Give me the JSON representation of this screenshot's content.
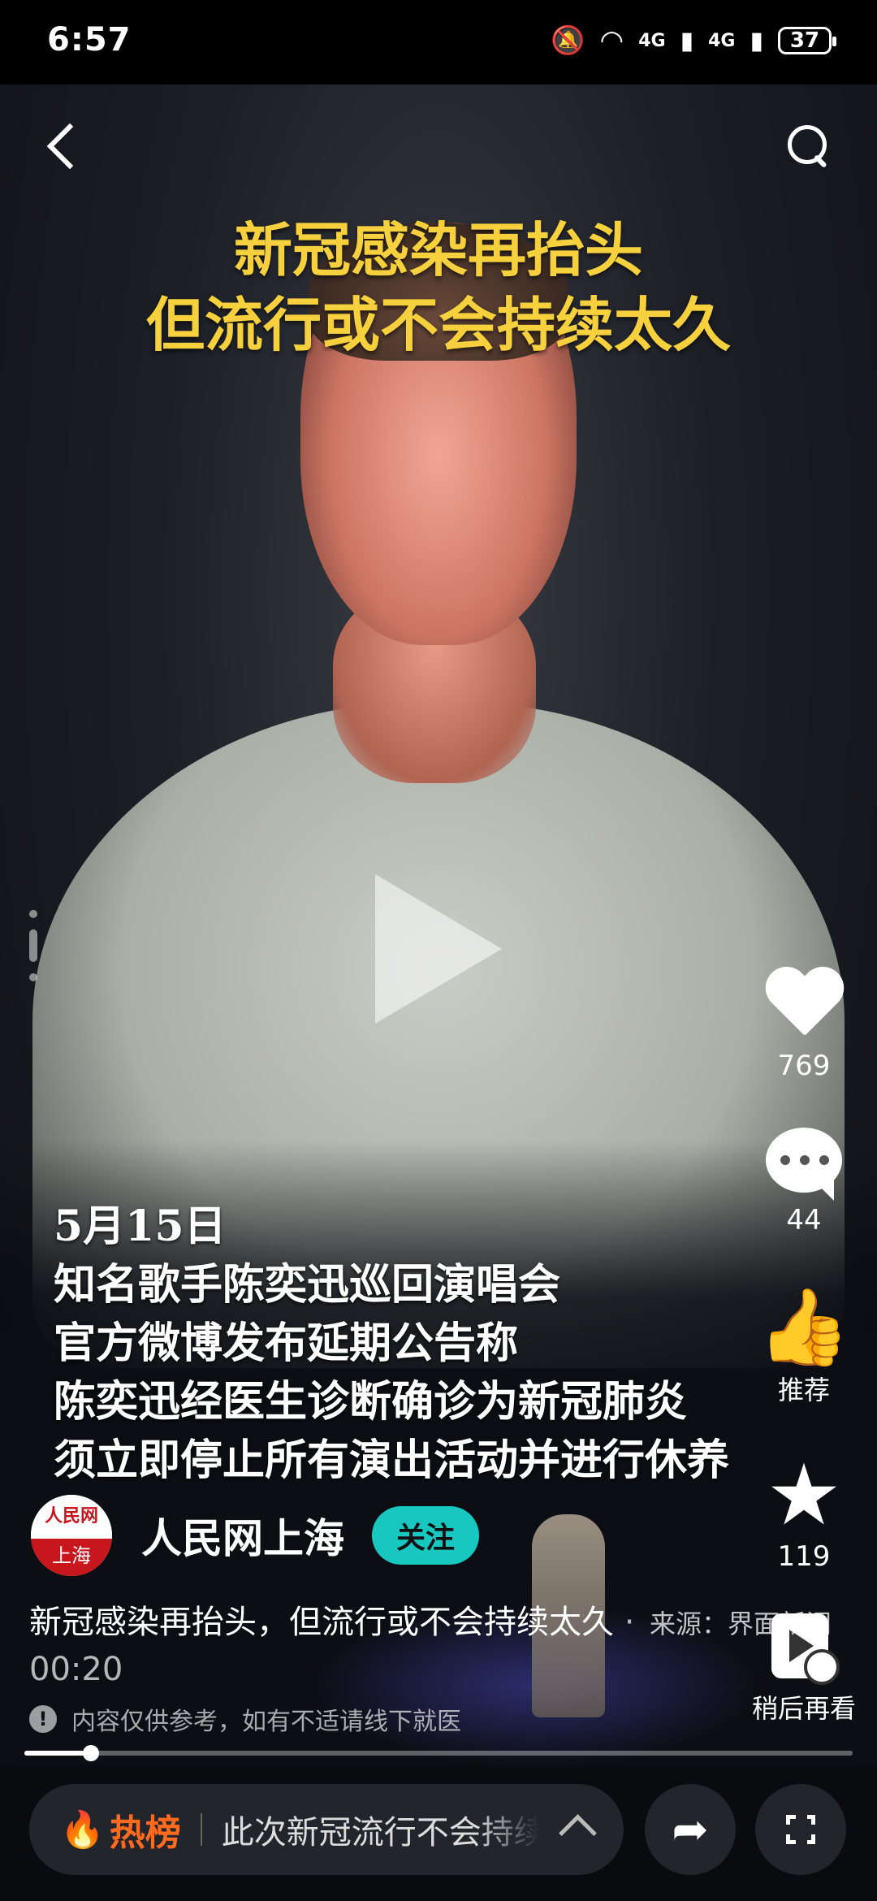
{
  "status": {
    "time": "6:57",
    "network_1": "4G",
    "network_2": "4G",
    "battery": "37"
  },
  "video": {
    "headline_line1": "新冠感染再抬头",
    "headline_line2": "但流行或不会持续太久",
    "caption": [
      "5月15日",
      "知名歌手陈奕迅巡回演唱会",
      "官方微博发布延期公告称",
      "陈奕迅经医生诊断确诊为新冠肺炎",
      "须立即停止所有演出活动并进行休养"
    ],
    "progress": 0.08
  },
  "rail": {
    "likes": "769",
    "comments": "44",
    "recommend_label": "推荐",
    "favorites": "119",
    "watch_later_label": "稍后再看"
  },
  "author": {
    "avatar_top": "人民网",
    "avatar_bottom": "上海",
    "name": "人民网上海",
    "follow_label": "关注"
  },
  "description": {
    "title": "新冠感染再抬头，但流行或不会持续太久",
    "time": "· 00:20",
    "source": "来源：界面新闻",
    "disclaimer": "内容仅供参考，如有不适请线下就医"
  },
  "bottom_bar": {
    "hot_label": "热榜",
    "hot_text": "此次新冠流行不会持续太久"
  },
  "icons": [
    "back-icon",
    "search-icon",
    "play-icon",
    "heart-icon",
    "comment-icon",
    "thumb-up-icon",
    "star-icon",
    "watch-later-icon",
    "flame-icon",
    "chevron-up-icon",
    "share-icon",
    "fullscreen-icon"
  ],
  "colors": {
    "headline": "#f7d13d",
    "follow_button": "#17c7c0",
    "hot_accent": "#ff6a1f",
    "brand_red": "#c8161d"
  }
}
